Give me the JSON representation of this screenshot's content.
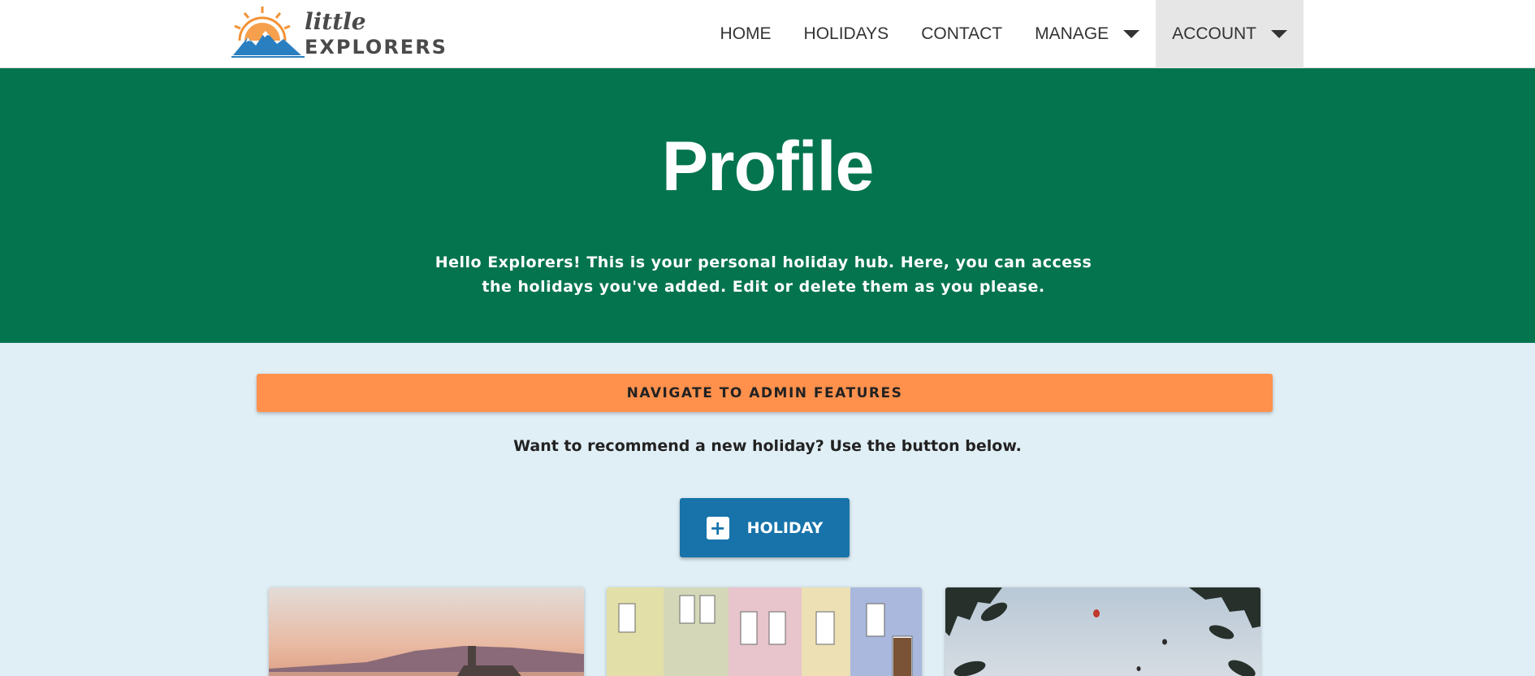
{
  "header": {
    "logo": {
      "small": "little",
      "big": "EXPLORERS"
    },
    "nav": [
      {
        "label": "HOME"
      },
      {
        "label": "HOLIDAYS"
      },
      {
        "label": "CONTACT"
      },
      {
        "label": "MANAGE"
      },
      {
        "label": "ACCOUNT"
      }
    ]
  },
  "hero": {
    "title": "Profile",
    "text": "Hello Explorers! This is your personal holiday hub. Here, you can access the holidays you've added. Edit or delete them as you please."
  },
  "content": {
    "admin_button": "NAVIGATE TO ADMIN FEATURES",
    "recommend_text": "Want to recommend a new holiday? Use the button below.",
    "add_button": "HOLIDAY"
  },
  "cards": [
    {
      "image": "coastal-sunset-photo"
    },
    {
      "image": "colorful-houses-photo"
    },
    {
      "image": "hot-air-balloons-photo"
    }
  ],
  "colors": {
    "hero": "#04744f",
    "admin_button": "#ff914d",
    "add_button": "#1773aa",
    "background": "#e0eef5"
  }
}
